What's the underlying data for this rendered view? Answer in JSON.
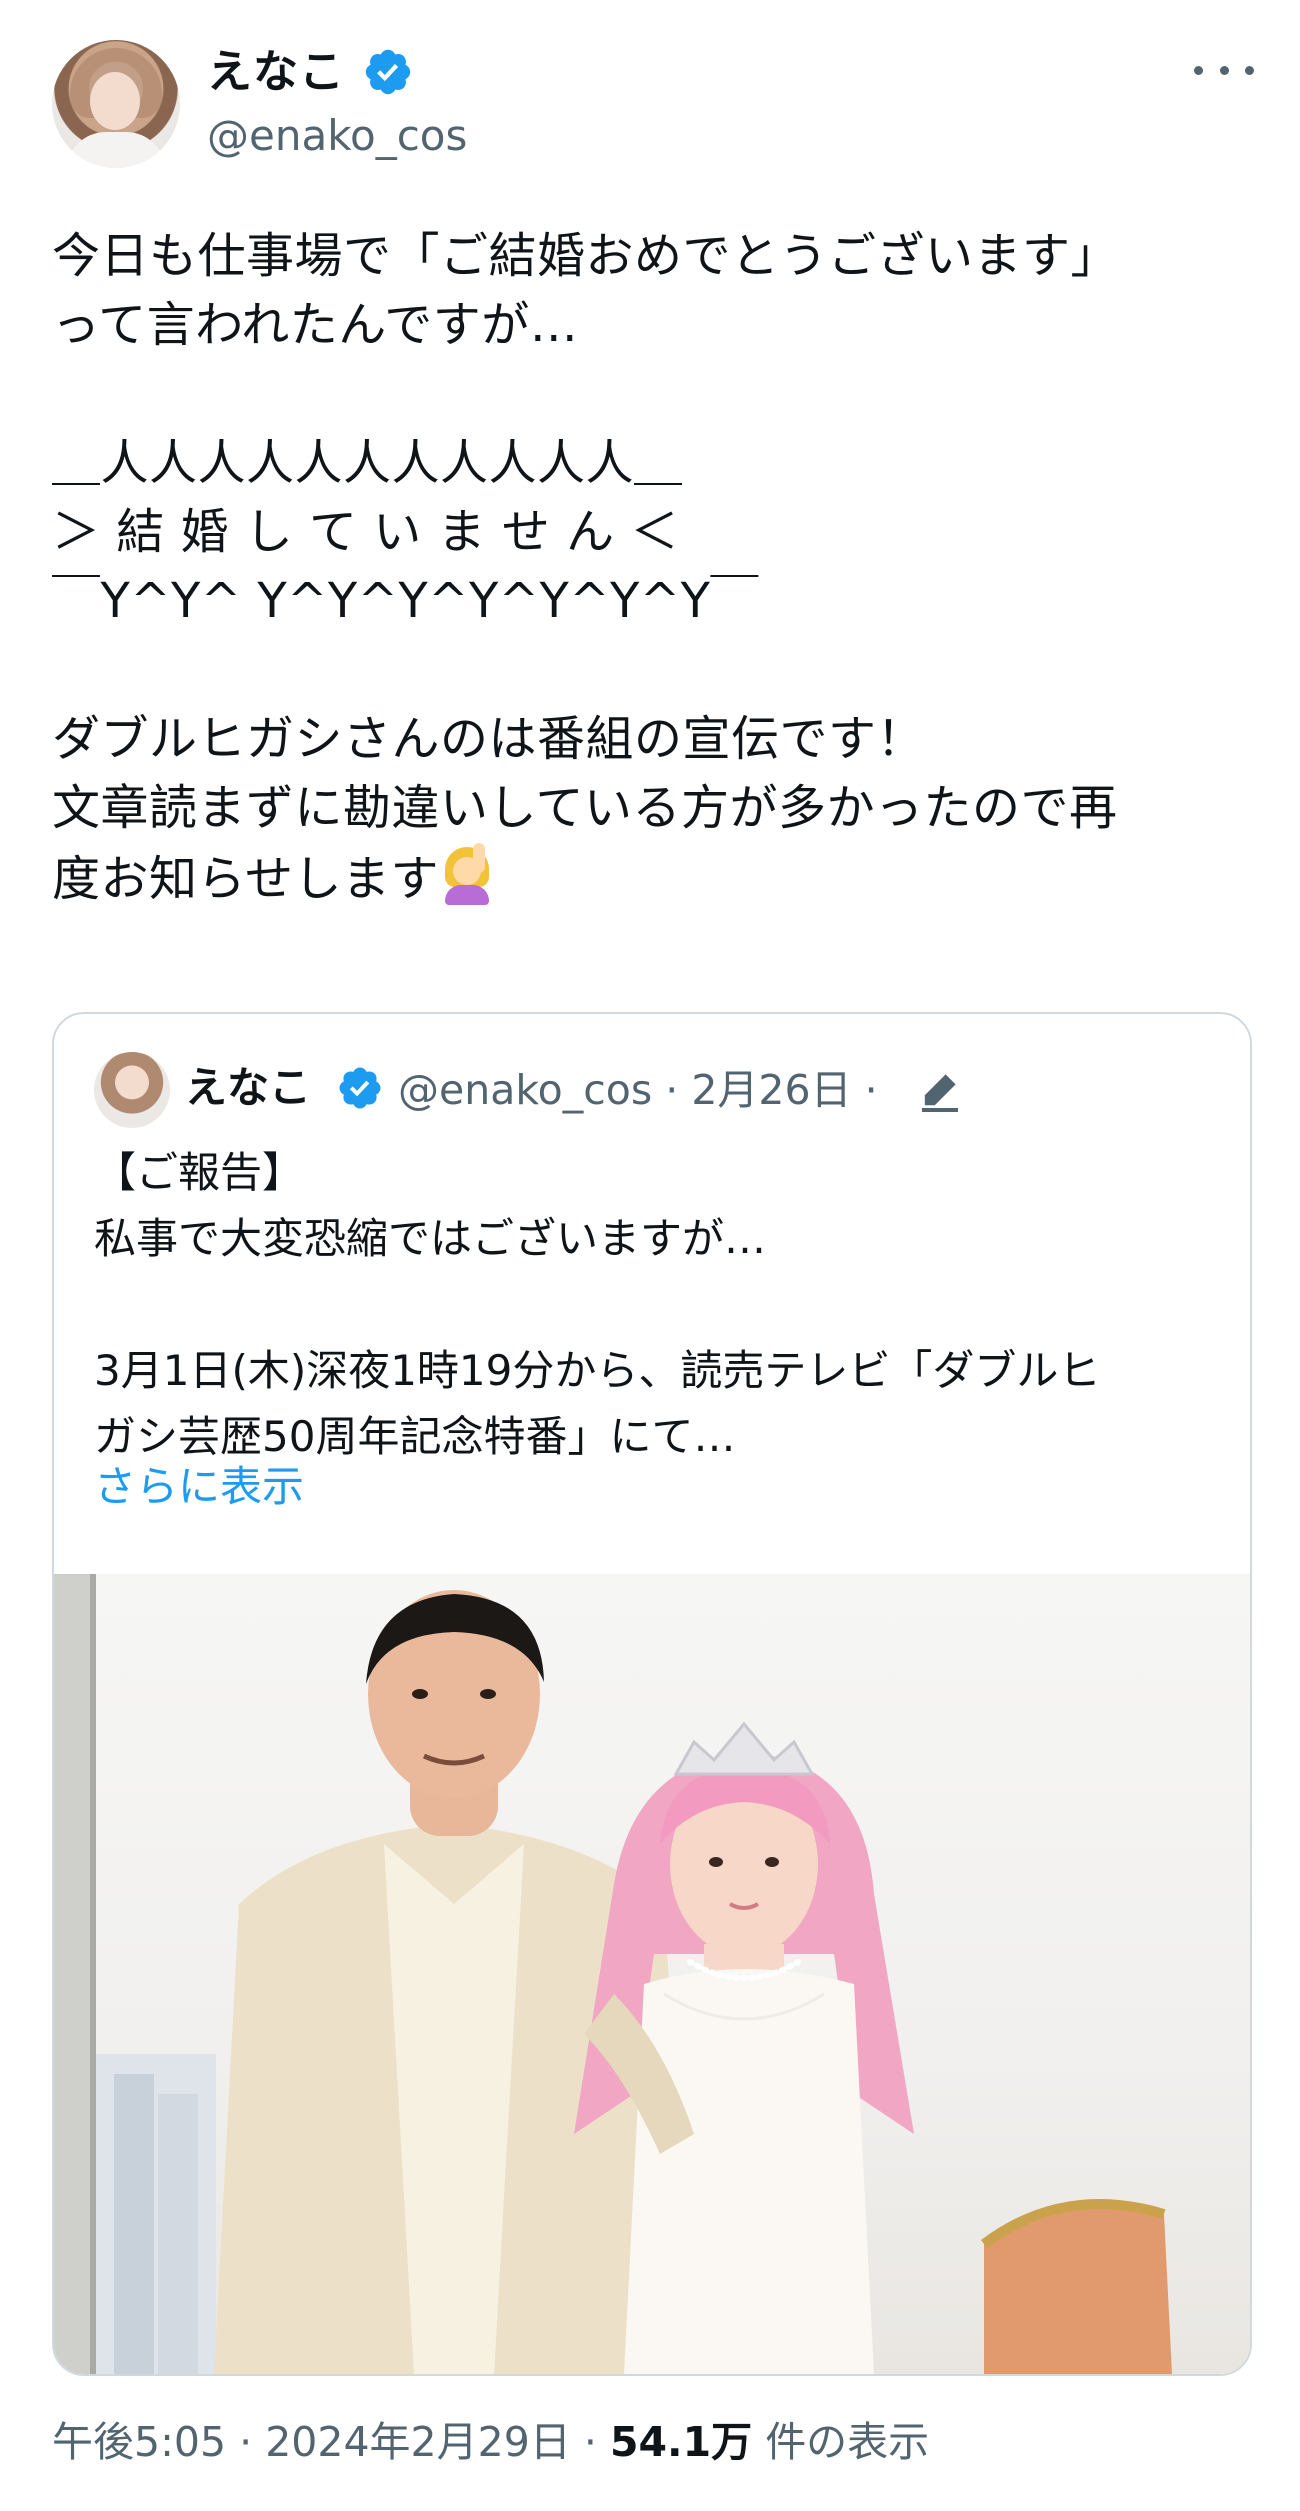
{
  "author": {
    "display_name": "えなこ",
    "handle": "@enako_cos",
    "verified": true
  },
  "tweet": {
    "lines": [
      "今日も仕事場で「ご結婚おめでとうございます」",
      "って言われたんですが…",
      "",
      "＿人人人人人人人人人人人＿",
      "＞ 結 婚 し て い ま せ ん ＜",
      "￣Y^Y^ Y^Y^Y^Y^Y^Y^Y￣",
      "",
      "ダブルヒガシさんのは番組の宣伝です！",
      "文章読まずに勘違いしている方が多かったので再",
      "度お知らせします"
    ],
    "emoji": "person-raising-hand-emoji"
  },
  "quote": {
    "display_name": "えなこ",
    "handle": "@enako_cos",
    "separator": "·",
    "date": "2月26日",
    "lines": [
      "【ご報告】",
      "私事で大変恐縮ではございますが…",
      "",
      "3月1日(木)深夜1時19分から、読売テレビ「ダブルヒ",
      "ガシ芸歴50周年記念特番」にて…"
    ],
    "show_more": "さらに表示",
    "photo_icon": "wedding-photo"
  },
  "footer": {
    "time": "午後5:05",
    "date": "2024年2月29日",
    "views_count": "54.1万",
    "views_label": "件の表示",
    "separator": "·"
  },
  "colors": {
    "verified_blue": "#1d9bf0",
    "secondary_text": "#536471",
    "border": "#cfd9de",
    "link": "#1d9bf0"
  }
}
